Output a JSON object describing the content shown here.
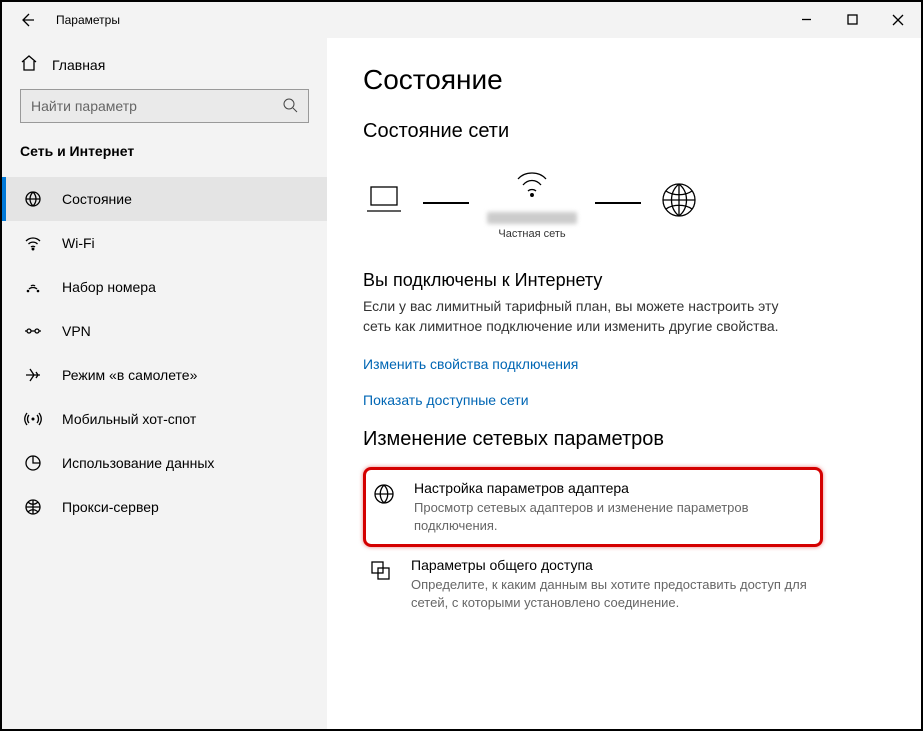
{
  "titlebar": {
    "title": "Параметры"
  },
  "sidebar": {
    "home": "Главная",
    "search_placeholder": "Найти параметр",
    "category": "Сеть и Интернет",
    "items": [
      {
        "icon": "globe-grid-icon",
        "label": "Состояние"
      },
      {
        "icon": "wifi-icon",
        "label": "Wi-Fi"
      },
      {
        "icon": "dialup-icon",
        "label": "Набор номера"
      },
      {
        "icon": "vpn-icon",
        "label": "VPN"
      },
      {
        "icon": "airplane-icon",
        "label": "Режим «в самолете»"
      },
      {
        "icon": "hotspot-icon",
        "label": "Мобильный хот-спот"
      },
      {
        "icon": "datausage-icon",
        "label": "Использование данных"
      },
      {
        "icon": "proxy-icon",
        "label": "Прокси-сервер"
      }
    ]
  },
  "main": {
    "title": "Состояние",
    "status_heading": "Состояние сети",
    "diagram_label": "Частная сеть",
    "connected_title": "Вы подключены к Интернету",
    "connected_body": "Если у вас лимитный тарифный план, вы можете настроить эту сеть как лимитное подключение или изменить другие свойства.",
    "link_props": "Изменить свойства подключения",
    "link_nets": "Показать доступные сети",
    "change_heading": "Изменение сетевых параметров",
    "options": [
      {
        "title": "Настройка параметров адаптера",
        "desc": "Просмотр сетевых адаптеров и изменение параметров подключения."
      },
      {
        "title": "Параметры общего доступа",
        "desc": "Определите, к каким данным вы хотите предоставить доступ для сетей, с которыми установлено соединение."
      }
    ]
  }
}
